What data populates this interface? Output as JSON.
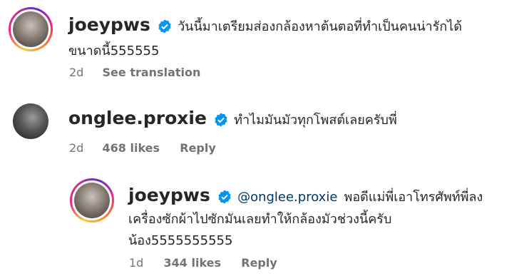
{
  "comments": [
    {
      "username": "joeypws",
      "text_line1": "วันนี้มาเตรียมส่องกล้องหาต้นตอที่ทำเป็นคนน่ารักได้",
      "text_line2": "ขนาดนี้555555",
      "time": "2d",
      "action": "See translation"
    },
    {
      "username": "onglee.proxie",
      "text_line1": "ทำไมมันมัวทุกโพสต์เลยครับพี่",
      "time": "2d",
      "likes": "468 likes",
      "action": "Reply"
    },
    {
      "username": "joeypws",
      "mention": "@onglee.proxie",
      "text_line1": "พอดีแม่พี่เอาโทรศัพท์พี่ลง",
      "text_line2": "เครื่องซักผ้าไปซักมันเลยทำให้กล้องมัวช่วงนี้ครับ",
      "text_line3": "น้อง5555555555",
      "time": "1d",
      "likes": "344 likes",
      "action": "Reply"
    }
  ],
  "icons": {
    "verified": "verified-badge-icon",
    "verified_color": "#0095f6"
  }
}
